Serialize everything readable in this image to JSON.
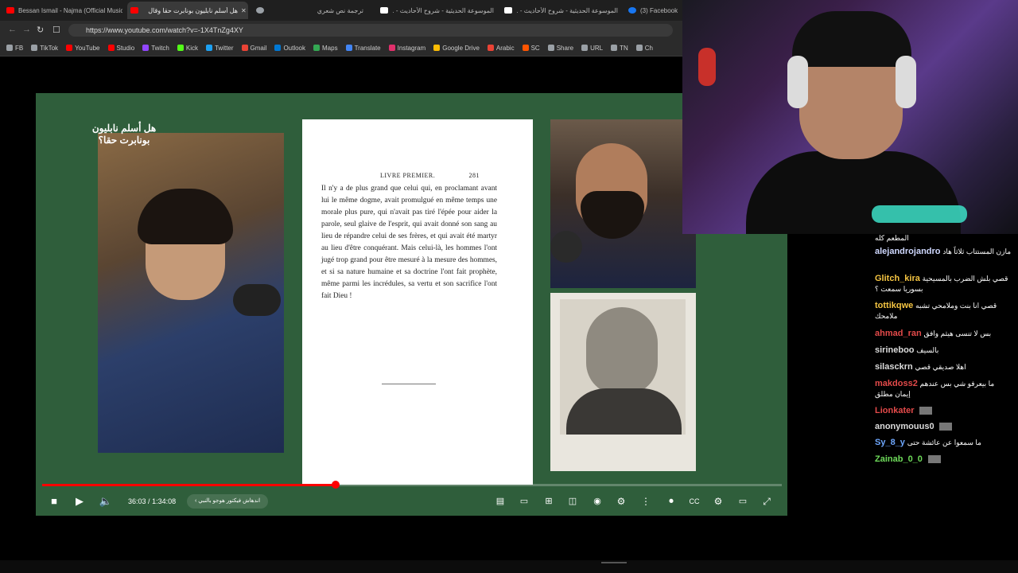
{
  "browser": {
    "tabs": [
      {
        "title": "Bessan Ismail - Najma (Official Music",
        "color": "#ff0000"
      },
      {
        "title": "هل أسلم نابليون بونابرت حقا وقال",
        "color": "#ff0000",
        "active": true
      },
      {
        "title": "ترجمة نص شعري",
        "color": "#9aa0a6"
      },
      {
        "title": "الموسوعة الحديثية - شروح الأحاديث - ...",
        "color": "#ffffff"
      },
      {
        "title": "الموسوعة الحديثية - شروح الأحاديث - ...",
        "color": "#ffffff"
      },
      {
        "title": "(3) Facebook",
        "color": "#1877f2"
      }
    ],
    "close_tab_glyph": "✕",
    "url": "https://www.youtube.com/watch?v=-1X4TnZg4XY",
    "bookmarks": [
      {
        "label": "FB",
        "icon": "folder-icon",
        "color": "#9aa0a6"
      },
      {
        "label": "TikTok",
        "icon": "folder-icon",
        "color": "#9aa0a6"
      },
      {
        "label": "YouTube",
        "icon": "youtube-icon",
        "color": "#ff0000"
      },
      {
        "label": "Studio",
        "icon": "studio-icon",
        "color": "#ff0000"
      },
      {
        "label": "Twitch",
        "icon": "twitch-icon",
        "color": "#9146ff"
      },
      {
        "label": "Kick",
        "icon": "kick-icon",
        "color": "#53fc18"
      },
      {
        "label": "Twitter",
        "icon": "twitter-icon",
        "color": "#1da1f2"
      },
      {
        "label": "Gmail",
        "icon": "gmail-icon",
        "color": "#ea4335"
      },
      {
        "label": "Outlook",
        "icon": "outlook-icon",
        "color": "#0078d4"
      },
      {
        "label": "Maps",
        "icon": "maps-icon",
        "color": "#34a853"
      },
      {
        "label": "Translate",
        "icon": "translate-icon",
        "color": "#4285f4"
      },
      {
        "label": "Instagram",
        "icon": "instagram-icon",
        "color": "#e1306c"
      },
      {
        "label": "Google Drive",
        "icon": "drive-icon",
        "color": "#fbbc04"
      },
      {
        "label": "Arabic",
        "icon": "arabic-icon",
        "color": "#ea4335"
      },
      {
        "label": "SC",
        "icon": "sc-icon",
        "color": "#ff5500"
      },
      {
        "label": "Share",
        "icon": "share-icon",
        "color": "#9aa0a6"
      },
      {
        "label": "URL",
        "icon": "url-icon",
        "color": "#9aa0a6"
      },
      {
        "label": "TN",
        "icon": "tn-icon",
        "color": "#9aa0a6"
      },
      {
        "label": "Ch",
        "icon": "ch-icon",
        "color": "#9aa0a6"
      }
    ]
  },
  "video": {
    "overlay_title_line1": "هل أسلم نابليون",
    "overlay_title_line2": "بونابرت حقا؟",
    "document": {
      "header_left": "LIVRE PREMIER.",
      "header_right": "281",
      "body": "Il n'y a de plus grand que celui qui, en proclamant avant lui le même dogme, avait promulgué en même temps une morale plus pure, qui n'avait pas tiré l'épée pour aider la parole, seul glaive de l'esprit, qui avait donné son sang au lieu de répandre celui de ses frères, et qui avait été martyr au lieu d'être conquérant. Mais celui-là, les hommes l'ont jugé trop grand pour être mesuré à la mesure des hommes, et si sa nature humaine et sa doctrine l'ont fait prophète, même parmi les incrédules, sa vertu et son sacrifice l'ont fait Dieu !"
    },
    "progress": 0.397,
    "time_current": "36:03",
    "time_total": "1:34:08",
    "time_separator": "/",
    "chapter": "اندهاش فيكتور هوجو بالنبي",
    "accent": "#ff0000",
    "background": "#2f5e3b"
  },
  "chat": {
    "messages": [
      {
        "user": "",
        "text": "المطعم كله",
        "color": "#ffffff"
      },
      {
        "user": "alejandrojandro",
        "text": "مازن المستتاب ثلاثاً هاد",
        "color": "#cfd8ff"
      },
      {
        "user": "Glitch_kira",
        "text": "قصي بلش الضرب بالمسيحية بسوريا سمعت ؟",
        "color": "#f5c542"
      },
      {
        "user": "tottikqwe",
        "text": "قصي انا بنت وملامحي تشبه ملامحك",
        "color": "#f5c542"
      },
      {
        "user": "ahmad_ran",
        "text": "بس لا تنسى هيثم وافق",
        "color": "#e34a4a"
      },
      {
        "user": "sirineboo",
        "text": "بالسيف",
        "color": "#dcdcdc"
      },
      {
        "user": "silasckrn",
        "text": "اهلا صديقي قصي",
        "color": "#dcdcdc"
      },
      {
        "user": "makdoss2",
        "text": "ما بيعرفو شي بس عندهم إيمان مطلق",
        "color": "#e34a4a"
      },
      {
        "user": "Lionkater",
        "text": "",
        "color": "#e34a4a"
      },
      {
        "user": "anonymouus0",
        "text": "",
        "color": "#dcdcdc"
      },
      {
        "user": "Sy_8_y",
        "text": "ما سمعوا عن عائشة حتى",
        "color": "#6fa8ff"
      },
      {
        "user": "Zainab_0_0",
        "text": "",
        "color": "#6edb5a"
      }
    ]
  }
}
